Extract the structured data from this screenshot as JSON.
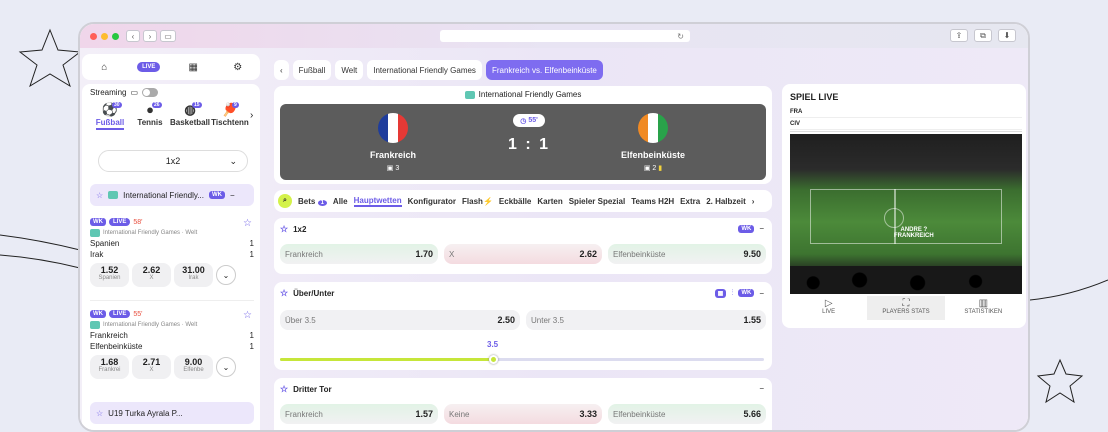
{
  "browser": {
    "url_icon": "↻"
  },
  "nav": {
    "live_label": "LIVE"
  },
  "sidebar": {
    "streaming_label": "Streaming",
    "sports": [
      {
        "label": "Fußball",
        "count": "30",
        "icon": "soccer-icon"
      },
      {
        "label": "Tennis",
        "count": "26",
        "icon": "tennis-icon"
      },
      {
        "label": "Basketball",
        "count": "15",
        "icon": "basketball-icon"
      },
      {
        "label": "Tischtenn",
        "count": "9",
        "icon": "table-tennis-icon"
      }
    ],
    "market_select": "1x2",
    "group": {
      "title": "International Friendly...",
      "badge": "WK",
      "collapse": "−"
    },
    "matches": [
      {
        "wk": "WK",
        "live": "LIVE",
        "minute": "58'",
        "competition": "International Friendly Games · Welt",
        "home": "Spanien",
        "away": "Irak",
        "home_score": "1",
        "away_score": "1",
        "odds": [
          {
            "v": "1.52",
            "l": "Spanien"
          },
          {
            "v": "2.62",
            "l": "X"
          },
          {
            "v": "31.00",
            "l": "Irak"
          }
        ]
      },
      {
        "wk": "WK",
        "live": "LIVE",
        "minute": "55'",
        "competition": "International Friendly Games · Welt",
        "home": "Frankreich",
        "away": "Elfenbeinküste",
        "home_score": "1",
        "away_score": "1",
        "odds": [
          {
            "v": "1.68",
            "l": "Frankrei"
          },
          {
            "v": "2.71",
            "l": "X"
          },
          {
            "v": "9.00",
            "l": "Elfenbe"
          }
        ]
      }
    ],
    "next_group": "U19 Turka Ayrala P..."
  },
  "breadcrumb": [
    "Fußball",
    "Welt",
    "International Friendly Games",
    "Frankreich vs. Elfenbeinküste"
  ],
  "scoreboard": {
    "competition": "International Friendly Games",
    "home": "Frankreich",
    "away": "Elfenbeinküste",
    "home_sub": "3",
    "away_sub": "2",
    "minute": "55'",
    "score": "1 : 1"
  },
  "tabs": [
    "Bets",
    "Alle",
    "Hauptwetten",
    "Konfigurator",
    "Flash",
    "Eckbälle",
    "Karten",
    "Spieler Spezial",
    "Teams H2H",
    "Extra",
    "2. Halbzeit"
  ],
  "tabs_bets_count": "1",
  "markets": {
    "m1": {
      "title": "1x2",
      "badge": "WK",
      "cells": [
        {
          "l": "Frankreich",
          "v": "1.70"
        },
        {
          "l": "X",
          "v": "2.62"
        },
        {
          "l": "Elfenbeinküste",
          "v": "9.50"
        }
      ]
    },
    "m2": {
      "title": "Über/Unter",
      "badge": "WK",
      "cells": [
        {
          "l": "Über 3.5",
          "v": "2.50"
        },
        {
          "l": "Unter 3.5",
          "v": "1.55"
        }
      ],
      "slider_value": "3.5",
      "slider_fraction": 0.44
    },
    "m3": {
      "title": "Dritter Tor",
      "cells": [
        {
          "l": "Frankreich",
          "v": "1.57"
        },
        {
          "l": "Keine",
          "v": "3.33"
        },
        {
          "l": "Elfenbeinküste",
          "v": "5.66"
        }
      ]
    }
  },
  "live": {
    "title": "SPIEL LIVE",
    "rows": [
      "FRA",
      "CIV"
    ],
    "overlay_small": "ANDRE ?",
    "overlay_team": "FRANKREICH",
    "tabs": [
      {
        "l": "LIVE",
        "i": "play-icon"
      },
      {
        "l": "PLAYERS STATS",
        "i": "players-icon"
      },
      {
        "l": "STATISTIKEN",
        "i": "stats-icon"
      }
    ]
  },
  "colors": {
    "accent": "#6c5ce7",
    "lime": "#c6e63a",
    "live_red": "#e84d3c"
  }
}
